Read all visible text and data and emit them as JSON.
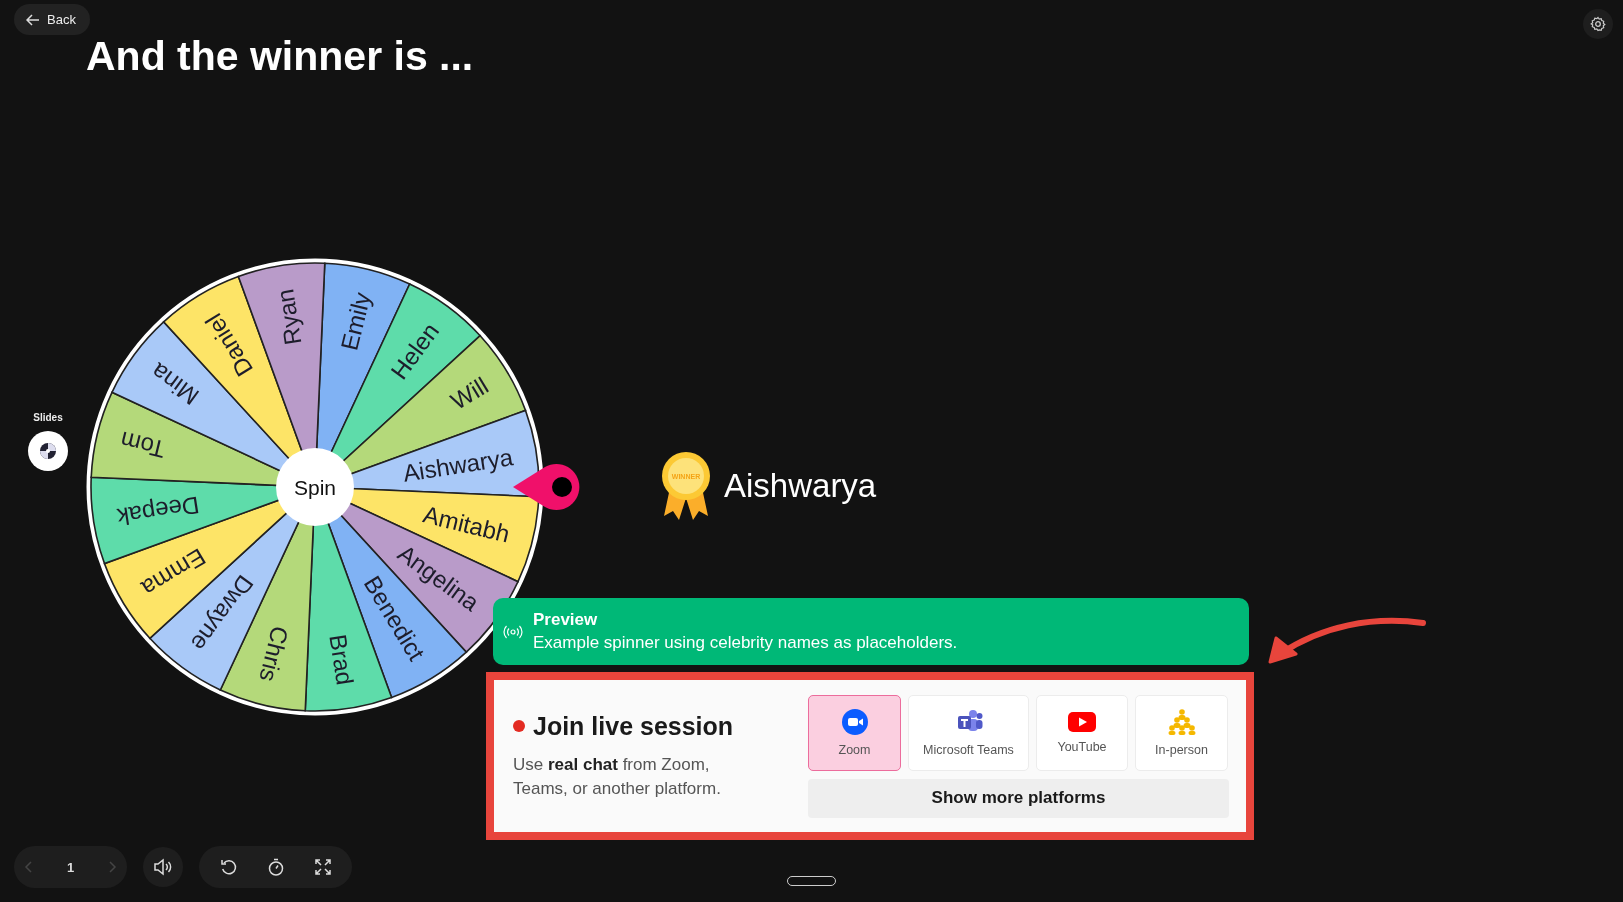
{
  "back_button": {
    "label": "Back"
  },
  "slide": {
    "title": "And the winner is ...",
    "wheel": {
      "center_label": "Spin",
      "segments": [
        {
          "name": "Emily",
          "color": "#80b2f4"
        },
        {
          "name": "Helen",
          "color": "#5edcaa"
        },
        {
          "name": "Will",
          "color": "#b4d97a"
        },
        {
          "name": "Aishwarya",
          "color": "#a9c9f8"
        },
        {
          "name": "Amitabh",
          "color": "#fde467"
        },
        {
          "name": "Angelina",
          "color": "#b99bc9"
        },
        {
          "name": "Benedict",
          "color": "#80b2f4"
        },
        {
          "name": "Brad",
          "color": "#5edcaa"
        },
        {
          "name": "Chris",
          "color": "#b4d97a"
        },
        {
          "name": "Dwayne",
          "color": "#a9c9f8"
        },
        {
          "name": "Emma",
          "color": "#fde467"
        },
        {
          "name": "Deepak",
          "color": "#5edcaa"
        },
        {
          "name": "Tom",
          "color": "#b4d97a"
        },
        {
          "name": "Mina",
          "color": "#a9c9f8"
        },
        {
          "name": "Daniel",
          "color": "#fde467"
        },
        {
          "name": "Ryan",
          "color": "#b99bc9"
        }
      ]
    },
    "winner": {
      "badge_text": "WINNER",
      "name": "Aishwarya"
    }
  },
  "slides_rail": {
    "label": "Slides"
  },
  "preview": {
    "title": "Preview",
    "message": "Example spinner using celebrity names as placeholders."
  },
  "live_session": {
    "title": "Join live session",
    "description": "Use **real chat** from Zoom, Teams, or another platform.",
    "platforms": [
      {
        "label": "Zoom",
        "kind": "zoom",
        "selected": true
      },
      {
        "label": "Microsoft Teams",
        "kind": "teams",
        "selected": false
      },
      {
        "label": "YouTube",
        "kind": "youtube",
        "selected": false
      },
      {
        "label": "In-person",
        "kind": "inperson",
        "selected": false
      }
    ],
    "more_button": "Show more platforms"
  },
  "controls": {
    "page": "1",
    "prev_disabled": true,
    "next_disabled": true
  }
}
